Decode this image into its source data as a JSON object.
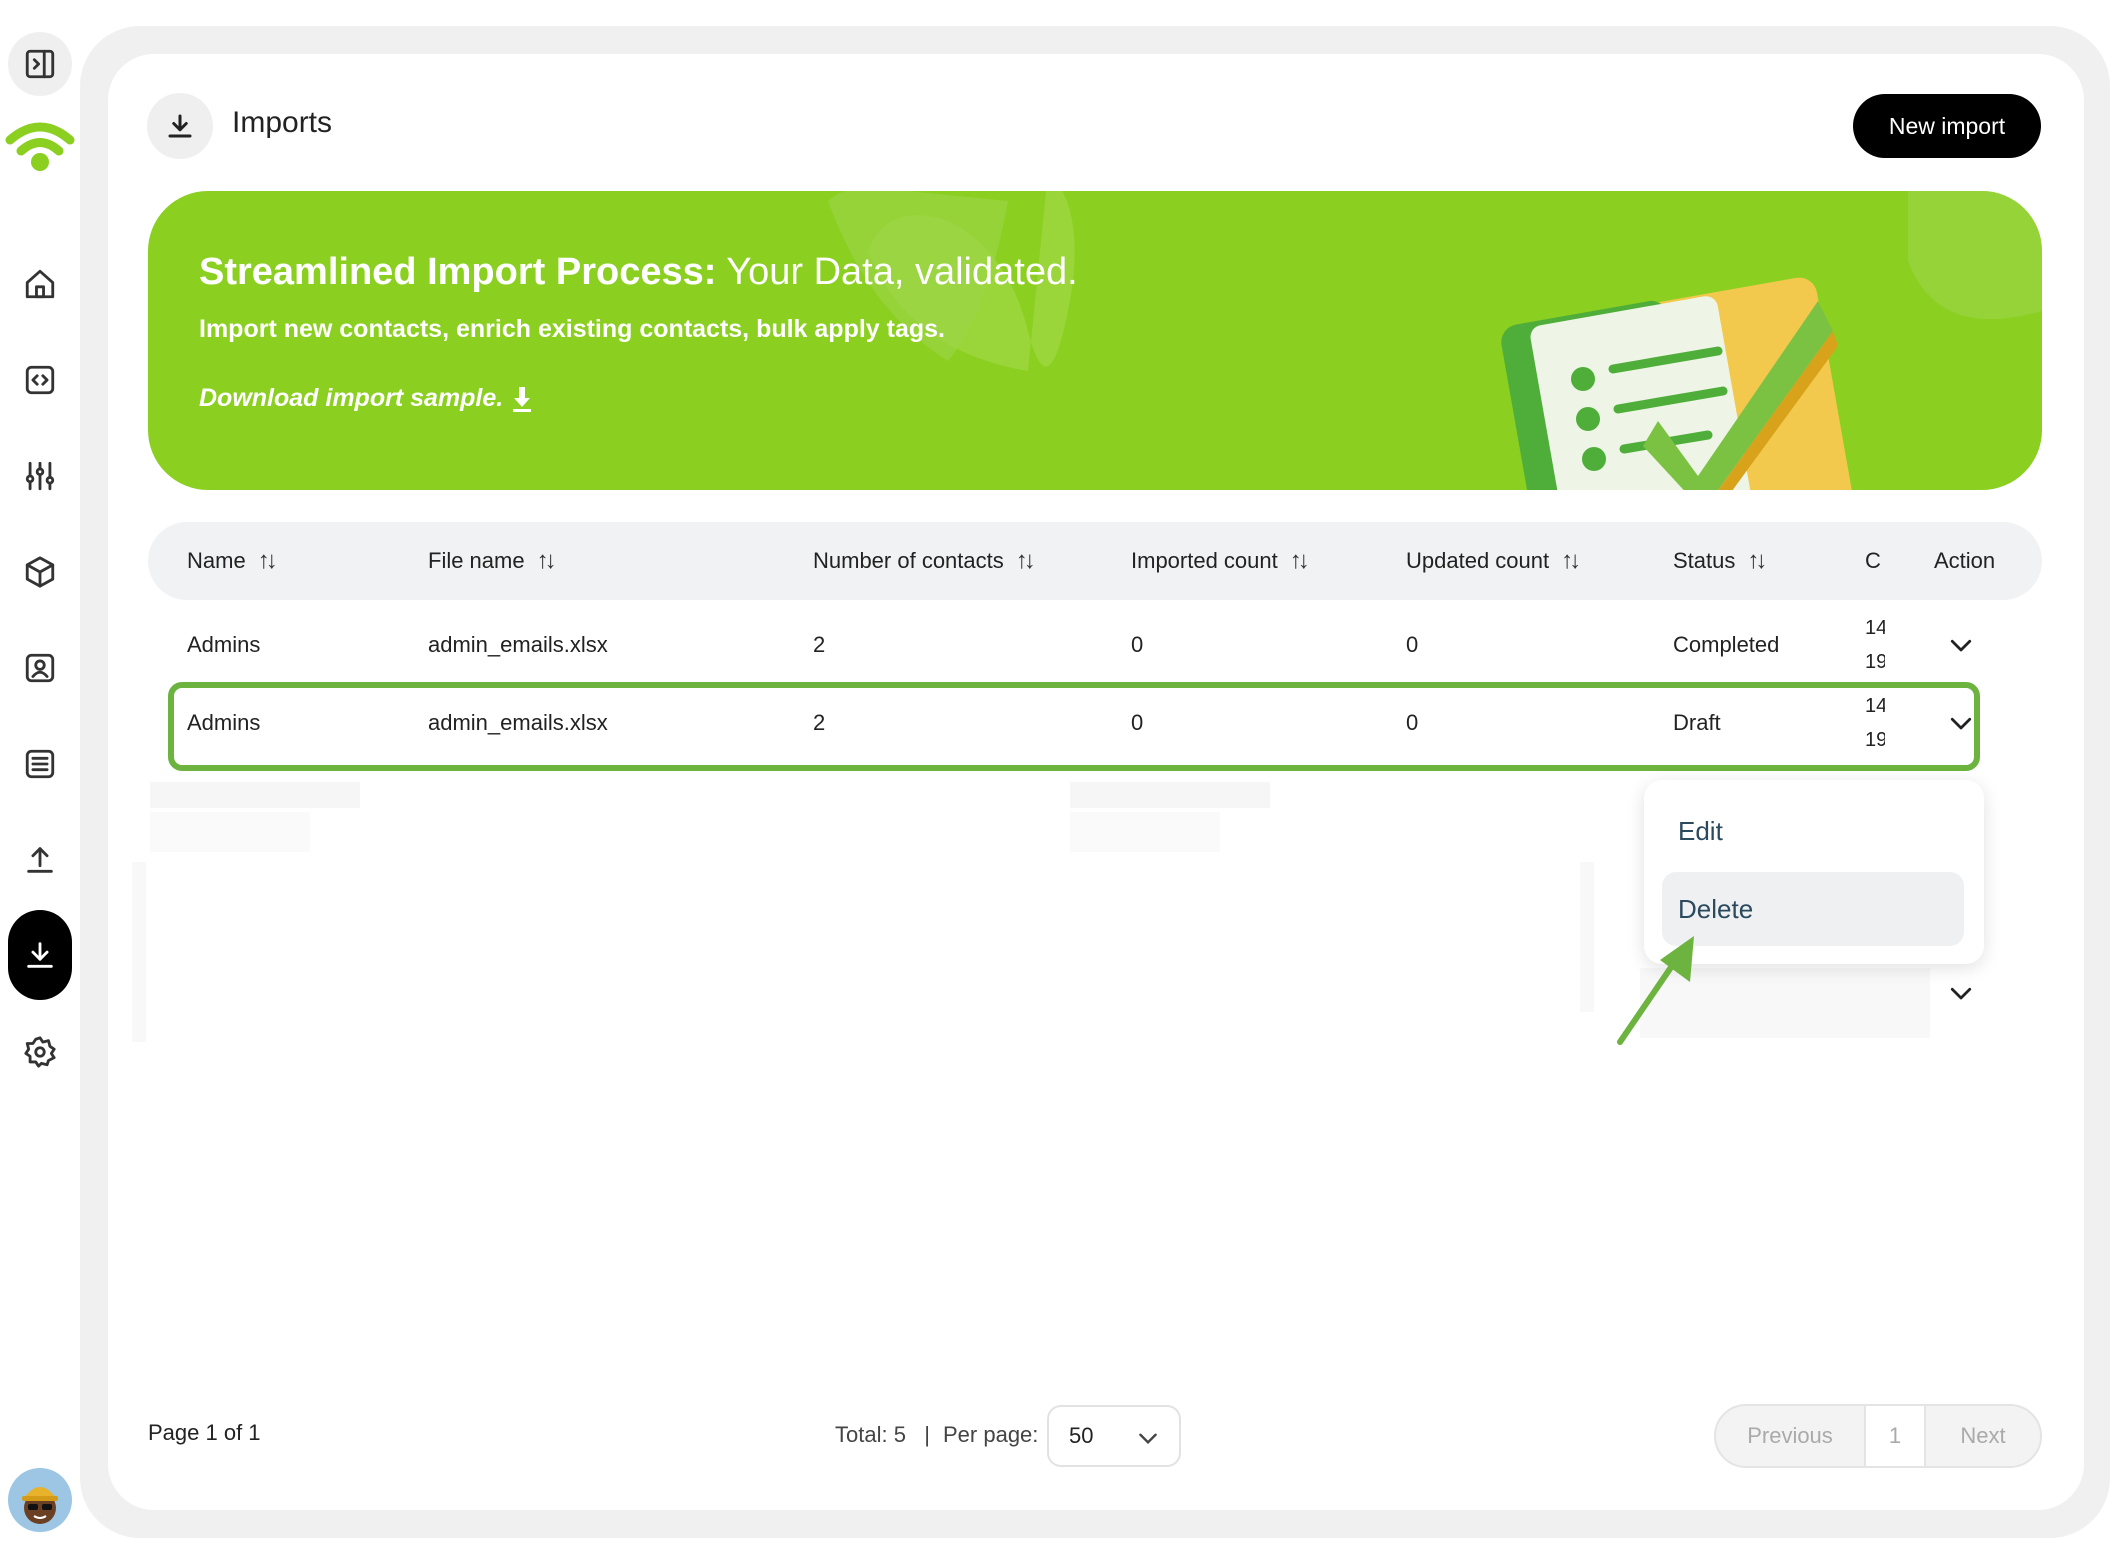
{
  "header": {
    "title": "Imports",
    "new_import_label": "New import"
  },
  "banner": {
    "title_bold": "Streamlined Import Process:",
    "title_rest": " Your Data, validated.",
    "subtitle": "Import new contacts, enrich existing contacts, bulk apply tags.",
    "download_link": "Download import sample."
  },
  "table": {
    "columns": [
      {
        "label": "Name"
      },
      {
        "label": "File name"
      },
      {
        "label": "Number of contacts"
      },
      {
        "label": "Imported count"
      },
      {
        "label": "Updated count"
      },
      {
        "label": "Status"
      },
      {
        "label": "C"
      },
      {
        "label": "Action"
      }
    ],
    "rows": [
      {
        "name": "Admins",
        "file_name": "admin_emails.xlsx",
        "contacts": "2",
        "imported": "0",
        "updated": "0",
        "status": "Completed",
        "date_line1": "14",
        "date_line2": "19"
      },
      {
        "name": "Admins",
        "file_name": "admin_emails.xlsx",
        "contacts": "2",
        "imported": "0",
        "updated": "0",
        "status": "Draft",
        "date_line1": "14",
        "date_line2": "19"
      }
    ]
  },
  "action_menu": {
    "edit_label": "Edit",
    "delete_label": "Delete"
  },
  "footer": {
    "page_info": "Page 1 of 1",
    "total": "Total: 5",
    "separator": "|",
    "per_page_label": "Per page:",
    "per_page_value": "50",
    "prev_label": "Previous",
    "current_page": "1",
    "next_label": "Next"
  },
  "colors": {
    "brand_green": "#8bcf20",
    "highlight_green": "#6cb33f",
    "primary_button": "#000000"
  },
  "icons": {
    "sidebar": [
      "sidebar-toggle-icon",
      "wifi-logo-icon",
      "home-icon",
      "code-icon",
      "sliders-icon",
      "cube-icon",
      "contact-card-icon",
      "list-icon",
      "upload-icon",
      "download-icon",
      "gear-icon"
    ],
    "header": "download-icon",
    "row_action": "chevron-down-icon"
  }
}
